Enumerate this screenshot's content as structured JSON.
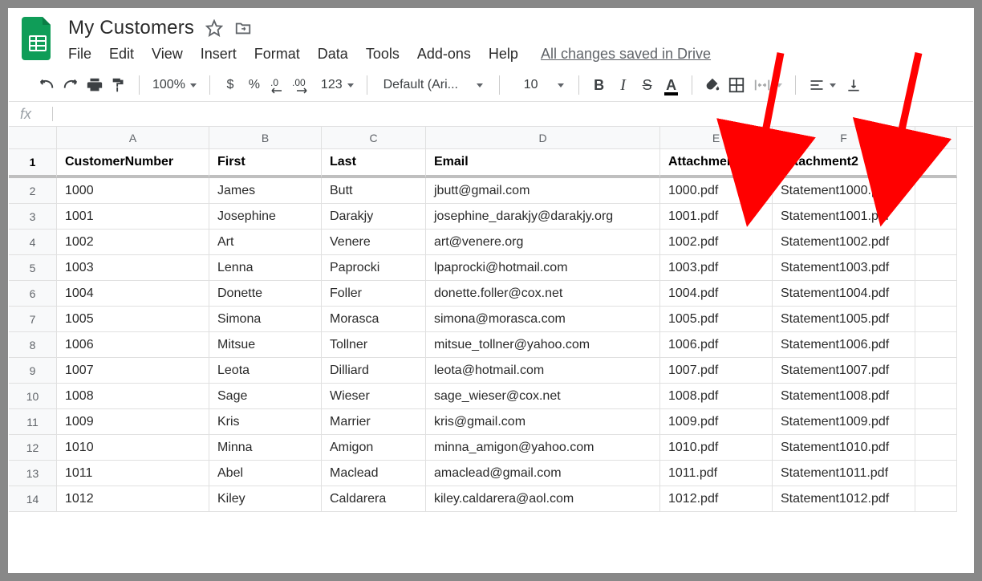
{
  "doc": {
    "title": "My Customers",
    "save_status": "All changes saved in Drive"
  },
  "menubar": [
    "File",
    "Edit",
    "View",
    "Insert",
    "Format",
    "Data",
    "Tools",
    "Add-ons",
    "Help"
  ],
  "toolbar": {
    "zoom": "100%",
    "currency": "$",
    "percent": "%",
    "dec_minus": ".0",
    "dec_plus": ".00",
    "num_format": "123",
    "font": "Default (Ari...",
    "font_size": "10"
  },
  "formula_bar": {
    "fx": "fx",
    "value": ""
  },
  "columns": [
    "A",
    "B",
    "C",
    "D",
    "E",
    "F",
    ""
  ],
  "headers": [
    "CustomerNumber",
    "First",
    "Last",
    "Email",
    "Attachment1",
    "Attachment2",
    ""
  ],
  "rows": [
    {
      "n": "2",
      "c": [
        "1000",
        "James",
        "Butt",
        "jbutt@gmail.com",
        "1000.pdf",
        "Statement1000.pdf",
        ""
      ]
    },
    {
      "n": "3",
      "c": [
        "1001",
        "Josephine",
        "Darakjy",
        "josephine_darakjy@darakjy.org",
        "1001.pdf",
        "Statement1001.pdf",
        ""
      ]
    },
    {
      "n": "4",
      "c": [
        "1002",
        "Art",
        "Venere",
        "art@venere.org",
        "1002.pdf",
        "Statement1002.pdf",
        ""
      ]
    },
    {
      "n": "5",
      "c": [
        "1003",
        "Lenna",
        "Paprocki",
        "lpaprocki@hotmail.com",
        "1003.pdf",
        "Statement1003.pdf",
        ""
      ]
    },
    {
      "n": "6",
      "c": [
        "1004",
        "Donette",
        "Foller",
        "donette.foller@cox.net",
        "1004.pdf",
        "Statement1004.pdf",
        ""
      ]
    },
    {
      "n": "7",
      "c": [
        "1005",
        "Simona",
        "Morasca",
        "simona@morasca.com",
        "1005.pdf",
        "Statement1005.pdf",
        ""
      ]
    },
    {
      "n": "8",
      "c": [
        "1006",
        "Mitsue",
        "Tollner",
        "mitsue_tollner@yahoo.com",
        "1006.pdf",
        "Statement1006.pdf",
        ""
      ]
    },
    {
      "n": "9",
      "c": [
        "1007",
        "Leota",
        "Dilliard",
        "leota@hotmail.com",
        "1007.pdf",
        "Statement1007.pdf",
        ""
      ]
    },
    {
      "n": "10",
      "c": [
        "1008",
        "Sage",
        "Wieser",
        "sage_wieser@cox.net",
        "1008.pdf",
        "Statement1008.pdf",
        ""
      ]
    },
    {
      "n": "11",
      "c": [
        "1009",
        "Kris",
        "Marrier",
        "kris@gmail.com",
        "1009.pdf",
        "Statement1009.pdf",
        ""
      ]
    },
    {
      "n": "12",
      "c": [
        "1010",
        "Minna",
        "Amigon",
        "minna_amigon@yahoo.com",
        "1010.pdf",
        "Statement1010.pdf",
        ""
      ]
    },
    {
      "n": "13",
      "c": [
        "1011",
        "Abel",
        "Maclead",
        "amaclead@gmail.com",
        "1011.pdf",
        "Statement1011.pdf",
        ""
      ]
    },
    {
      "n": "14",
      "c": [
        "1012",
        "Kiley",
        "Caldarera",
        "kiley.caldarera@aol.com",
        "1012.pdf",
        "Statement1012.pdf",
        ""
      ]
    }
  ],
  "annotations": {
    "arrow_color": "#ff0000"
  }
}
